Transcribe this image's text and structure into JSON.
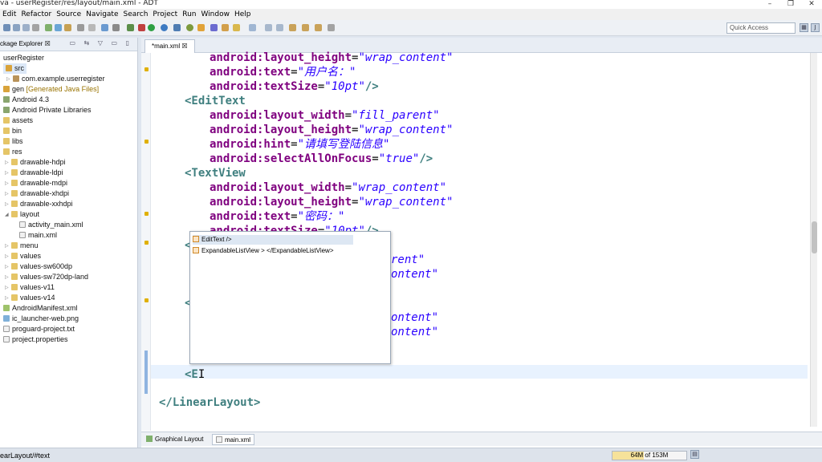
{
  "window": {
    "title": "va - userRegister/res/layout/main.xml - ADT",
    "controls": [
      "–",
      "❐",
      "✕"
    ]
  },
  "menu": [
    "Edit",
    "Refactor",
    "Source",
    "Navigate",
    "Search",
    "Project",
    "Run",
    "Window",
    "Help"
  ],
  "toolbar": {
    "quick_access_placeholder": "Quick Access"
  },
  "package_explorer": {
    "tab_label": "ckage Explorer ☒",
    "items": [
      {
        "label": "userRegister"
      },
      {
        "label": "src"
      },
      {
        "label": "com.example.userregister"
      },
      {
        "label": "gen",
        "note": "[Generated Java Files]"
      },
      {
        "label": "Android 4.3"
      },
      {
        "label": "Android Private Libraries"
      },
      {
        "label": "assets"
      },
      {
        "label": "bin"
      },
      {
        "label": "libs"
      },
      {
        "label": "res"
      },
      {
        "label": "drawable-hdpi"
      },
      {
        "label": "drawable-ldpi"
      },
      {
        "label": "drawable-mdpi"
      },
      {
        "label": "drawable-xhdpi"
      },
      {
        "label": "drawable-xxhdpi"
      },
      {
        "label": "layout"
      },
      {
        "label": "activity_main.xml"
      },
      {
        "label": "main.xml"
      },
      {
        "label": "menu"
      },
      {
        "label": "values"
      },
      {
        "label": "values-sw600dp"
      },
      {
        "label": "values-sw720dp-land"
      },
      {
        "label": "values-v11"
      },
      {
        "label": "values-v14"
      },
      {
        "label": "AndroidManifest.xml"
      },
      {
        "label": "ic_launcher-web.png"
      },
      {
        "label": "proguard-project.txt"
      },
      {
        "label": "project.properties"
      }
    ]
  },
  "editor": {
    "tab_label": "*main.xml ☒",
    "lines": [
      {
        "attr": "android:layout_height",
        "val": "\"wrap_content\""
      },
      {
        "attr": "android:text",
        "val": "\"用户名：\"",
        "end": "/>"
      },
      {
        "attr": "android:textSize",
        "val": "\"10pt\"",
        "end": "/>"
      },
      {
        "tag": "<EditText"
      },
      {
        "attr": "android:layout_width",
        "val": "\"fill_parent\""
      },
      {
        "attr": "android:layout_height",
        "val": "\"wrap_content\""
      },
      {
        "attr": "android:hint",
        "val": "\"请填写登陆信息\""
      },
      {
        "attr": "android:selectAllOnFocus",
        "val": "\"true\"",
        "end": "/>"
      },
      {
        "tag": "<TextView"
      },
      {
        "attr": "android:layout_width",
        "val": "\"wrap_content\""
      },
      {
        "attr": "android:layout_height",
        "val": "\"wrap_content\""
      },
      {
        "attr": "android:text",
        "val": "\"密码：\""
      },
      {
        "attr": "android:textSize",
        "val": "\"10pt\"",
        "end": "/>"
      },
      {
        "tag": "<"
      },
      {
        "val": "rent\""
      },
      {
        "val": "ontent\""
      },
      {
        "tag": "<"
      },
      {
        "val": "ontent\""
      },
      {
        "val": "ontent\""
      },
      {
        "typing": "<E"
      },
      {
        "close": "</LinearLayout>"
      }
    ],
    "autocomplete": [
      {
        "label": "EditText />"
      },
      {
        "label": "ExpandableListView > </ExpandableListView>"
      }
    ]
  },
  "bottom_tabs": [
    "Graphical Layout",
    "main.xml"
  ],
  "status": {
    "path": "earLayout/#text",
    "memory": "64M of 153M",
    "memory_used_fraction": 0.42
  }
}
